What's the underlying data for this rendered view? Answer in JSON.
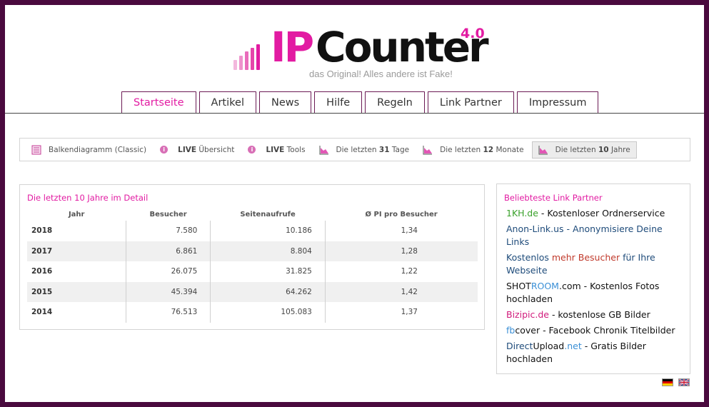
{
  "logo": {
    "ip": "IP",
    "counter": "Counter",
    "version": "4.0",
    "slogan": "das Original! Alles andere ist Fake!",
    "colors": {
      "accent": "#e21ba2",
      "dark": "#111111"
    }
  },
  "nav": {
    "tabs": [
      {
        "label": "Startseite",
        "active": true
      },
      {
        "label": "Artikel"
      },
      {
        "label": "News"
      },
      {
        "label": "Hilfe"
      },
      {
        "label": "Regeln"
      },
      {
        "label": "Link Partner"
      },
      {
        "label": "Impressum"
      }
    ]
  },
  "toolbar": {
    "items": [
      {
        "icon": "list-icon",
        "pre": "Balkendiagramm (Classic)",
        "bold": "",
        "post": ""
      },
      {
        "icon": "info-icon",
        "pre": "",
        "bold": "LIVE",
        "post": " Übersicht"
      },
      {
        "icon": "info-icon",
        "pre": "",
        "bold": "LIVE",
        "post": " Tools"
      },
      {
        "icon": "area-chart-icon",
        "pre": "Die letzten ",
        "bold": "31",
        "post": " Tage"
      },
      {
        "icon": "area-chart-icon",
        "pre": "Die letzten ",
        "bold": "12",
        "post": " Monate"
      },
      {
        "icon": "area-chart-icon",
        "pre": "Die letzten ",
        "bold": "10",
        "post": " Jahre",
        "active": true
      }
    ]
  },
  "stats": {
    "title": "Die letzten 10 Jahre im Detail",
    "headers": [
      "Jahr",
      "Besucher",
      "Seitenaufrufe",
      "Ø PI pro Besucher"
    ],
    "rows": [
      [
        "2018",
        "7.580",
        "10.186",
        "1,34"
      ],
      [
        "2017",
        "6.861",
        "8.804",
        "1,28"
      ],
      [
        "2016",
        "26.075",
        "31.825",
        "1,22"
      ],
      [
        "2015",
        "45.394",
        "64.262",
        "1,42"
      ],
      [
        "2014",
        "76.513",
        "105.083",
        "1,37"
      ]
    ]
  },
  "partners": {
    "title": "Beliebteste Link Partner",
    "items": [
      {
        "parts": [
          {
            "t": "1KH.de",
            "c": "c-green"
          },
          {
            "t": " - Kostenloser Ordnerservice",
            "c": "c-dark"
          }
        ]
      },
      {
        "parts": [
          {
            "t": "Anon-Link.us - Anonymisiere Deine Links",
            "c": "c-navy"
          }
        ]
      },
      {
        "parts": [
          {
            "t": "Kostenlos ",
            "c": "c-navy"
          },
          {
            "t": "mehr Besucher",
            "c": "c-red"
          },
          {
            "t": " für Ihre Webseite",
            "c": "c-navy"
          }
        ]
      },
      {
        "parts": [
          {
            "t": "SHOT",
            "c": "c-dark"
          },
          {
            "t": "ROOM",
            "c": "c-blue"
          },
          {
            "t": ".com - Kostenlos Fotos hochladen",
            "c": "c-dark"
          }
        ]
      },
      {
        "parts": [
          {
            "t": "Bizipic.de",
            "c": "c-pink"
          },
          {
            "t": " - kostenlose GB Bilder",
            "c": "c-dark"
          }
        ]
      },
      {
        "parts": [
          {
            "t": "fb",
            "c": "c-blue"
          },
          {
            "t": "cover - Facebook Chronik Titelbilder",
            "c": "c-dark"
          }
        ]
      },
      {
        "parts": [
          {
            "t": "Direct",
            "c": "c-navy"
          },
          {
            "t": "Upload",
            "c": "c-dark"
          },
          {
            "t": ".net",
            "c": "c-blue"
          },
          {
            "t": " - Gratis Bilder hochladen",
            "c": "c-dark"
          }
        ]
      }
    ]
  },
  "flags": [
    {
      "icon": "german-flag-icon"
    },
    {
      "icon": "uk-flag-icon"
    }
  ]
}
